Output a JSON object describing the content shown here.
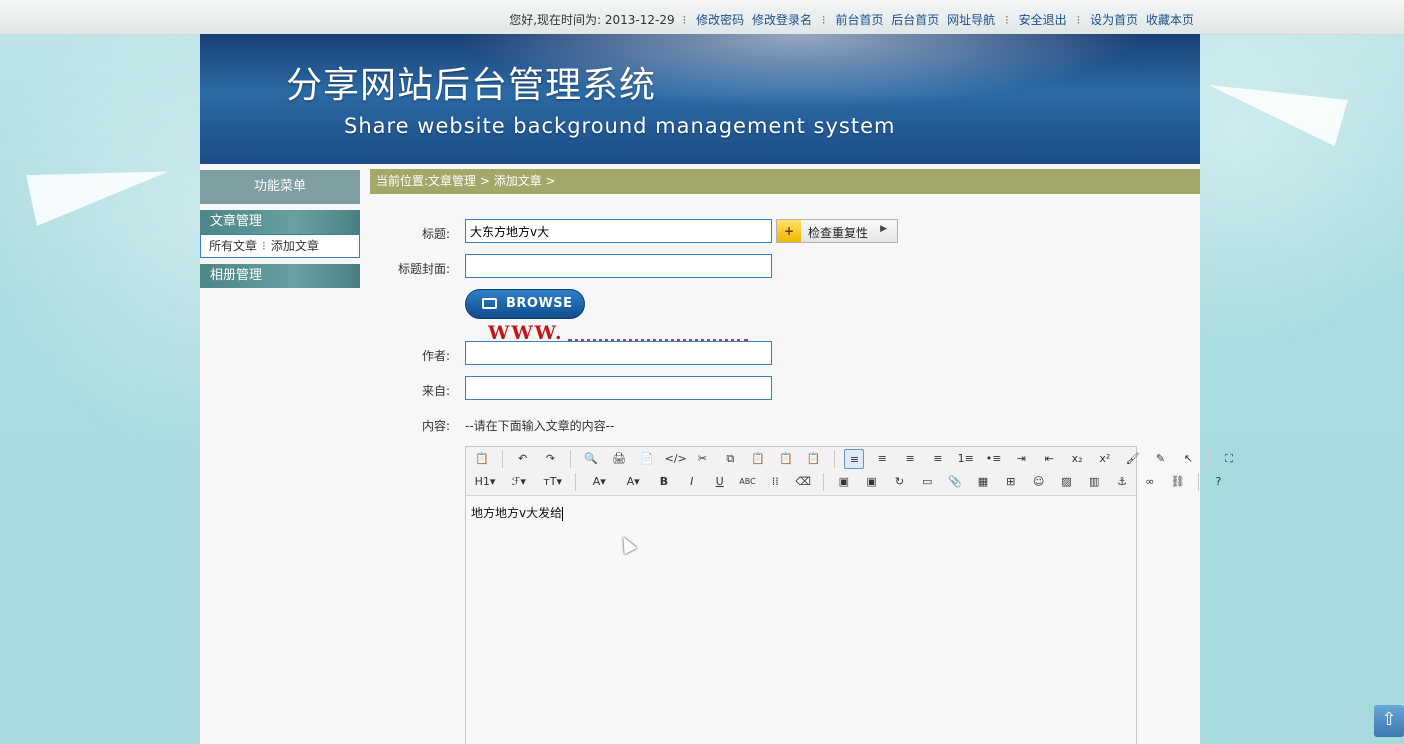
{
  "topbar": {
    "greeting": "您好,现在时间为: 2013-12-29",
    "links_group1": [
      "修改密码",
      "修改登录名"
    ],
    "links_group2": [
      "前台首页",
      "后台首页",
      "网址导航"
    ],
    "logout": "安全退出",
    "links_group4": [
      "设为首页",
      "收藏本页"
    ]
  },
  "banner": {
    "title_cn": "分享网站后台管理系统",
    "title_en": "Share website background management system"
  },
  "sidebar": {
    "menu_title": "功能菜单",
    "section_article": "文章管理",
    "sub_all": "所有文章",
    "sub_add": "添加文章",
    "section_album": "相册管理"
  },
  "breadcrumb": "当前位置:文章管理 > 添加文章 >",
  "form": {
    "title_label": "标题:",
    "title_value": "大东方地方v大",
    "check_button": "检查重复性",
    "cover_label": "标题封面:",
    "cover_value": "",
    "browse_label": "BROWSE",
    "watermark": "WWW.",
    "author_label": "作者:",
    "author_value": "",
    "source_label": "来自:",
    "source_value": "",
    "content_label": "内容:",
    "content_hint": "--请在下面输入文章的内容--"
  },
  "editor": {
    "body_text": "地方地方v大发给",
    "toolbar_row1": [
      "📋",
      "↶",
      "↷",
      "🔍",
      "🖨",
      "📄",
      "</>",
      "✂",
      "⧉",
      "📋",
      "📋",
      "📋",
      "≡",
      "≡",
      "≡",
      "≡",
      "1≡",
      "•≡",
      "⇥",
      "⇤",
      "x₂",
      "x²",
      "🖌",
      "✎",
      "↖",
      "⛶"
    ],
    "toolbar_row2": [
      "H1▾",
      "ℱ▾",
      "тT▾",
      "A▾",
      "A▾",
      "B",
      "I",
      "U",
      "ABC",
      "⁞⁞",
      "⌫",
      "▣",
      "▣",
      "↻",
      "▭",
      "📎",
      "▦",
      "⊞",
      "☺",
      "▨",
      "▥",
      "⚓",
      "∞",
      "⛓",
      "?"
    ]
  },
  "colors": {
    "accent_blue": "#3b7fb8",
    "breadcrumb_bg": "#a3a86a",
    "sidebar_header": "#7f9ea2",
    "sidebar_section": "#4d8587",
    "watermark_red": "#c4141a"
  }
}
